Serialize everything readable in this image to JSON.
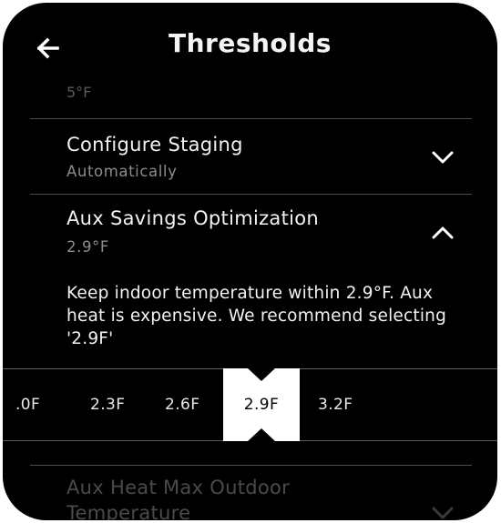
{
  "header": {
    "title": "Thresholds",
    "partial_prev_value": "5°F"
  },
  "rows": {
    "configure_staging": {
      "title": "Configure Staging",
      "value": "Automatically",
      "expanded": false
    },
    "aux_savings": {
      "title": "Aux Savings Optimization",
      "value": "2.9°F",
      "expanded": true,
      "description": "Keep indoor temperature within 2.9°F. Aux heat is expensive. We recommend selecting '2.9F'"
    },
    "aux_heat_max": {
      "title": "Aux Heat Max Outdoor Temperature"
    }
  },
  "selector": {
    "options": [
      ".0F",
      "2.3F",
      "2.6F",
      "2.9F",
      "3.2F"
    ],
    "selected": "2.9F"
  },
  "icons": {
    "back": "arrow-left-icon",
    "expand": "chevron-down-icon",
    "collapse": "chevron-up-icon"
  }
}
